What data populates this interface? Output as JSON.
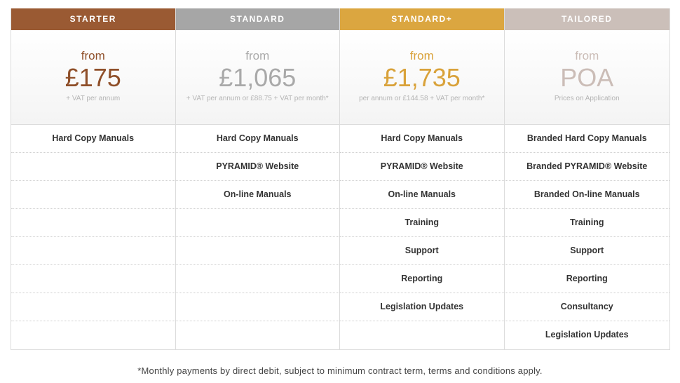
{
  "plans": [
    {
      "name": "STARTER",
      "header_color": "#9a5a33",
      "price_color": "#8f4f29",
      "from": "from",
      "price": "£175",
      "note": "+ VAT per annum",
      "features": [
        "Hard Copy Manuals",
        "",
        "",
        "",
        "",
        "",
        "",
        ""
      ]
    },
    {
      "name": "STANDARD",
      "header_color": "#a6a6a6",
      "price_color": "#a9a9a9",
      "from": "from",
      "price": "£1,065",
      "note": "+ VAT per annum or £88.75 + VAT per month*",
      "features": [
        "Hard Copy Manuals",
        "PYRAMID® Website",
        "On-line Manuals",
        "",
        "",
        "",
        "",
        ""
      ]
    },
    {
      "name": "STANDARD+",
      "header_color": "#dba640",
      "price_color": "#d9a23a",
      "from": "from",
      "price": "£1,735",
      "note": "per annum or £144.58 + VAT per month*",
      "features": [
        "Hard Copy Manuals",
        "PYRAMID® Website",
        "On-line Manuals",
        "Training",
        "Support",
        "Reporting",
        "Legislation Updates",
        ""
      ]
    },
    {
      "name": "TAILORED",
      "header_color": "#cbbfb9",
      "price_color": "#cbbdb7",
      "from": "from",
      "price": "POA",
      "note": "Prices on Application",
      "features": [
        "Branded Hard Copy Manuals",
        "Branded PYRAMID® Website",
        "Branded On-line Manuals",
        "Training",
        "Support",
        "Reporting",
        "Consultancy",
        "Legislation Updates"
      ]
    }
  ],
  "footnote": "*Monthly payments by direct debit, subject to minimum contract term, terms and conditions apply."
}
